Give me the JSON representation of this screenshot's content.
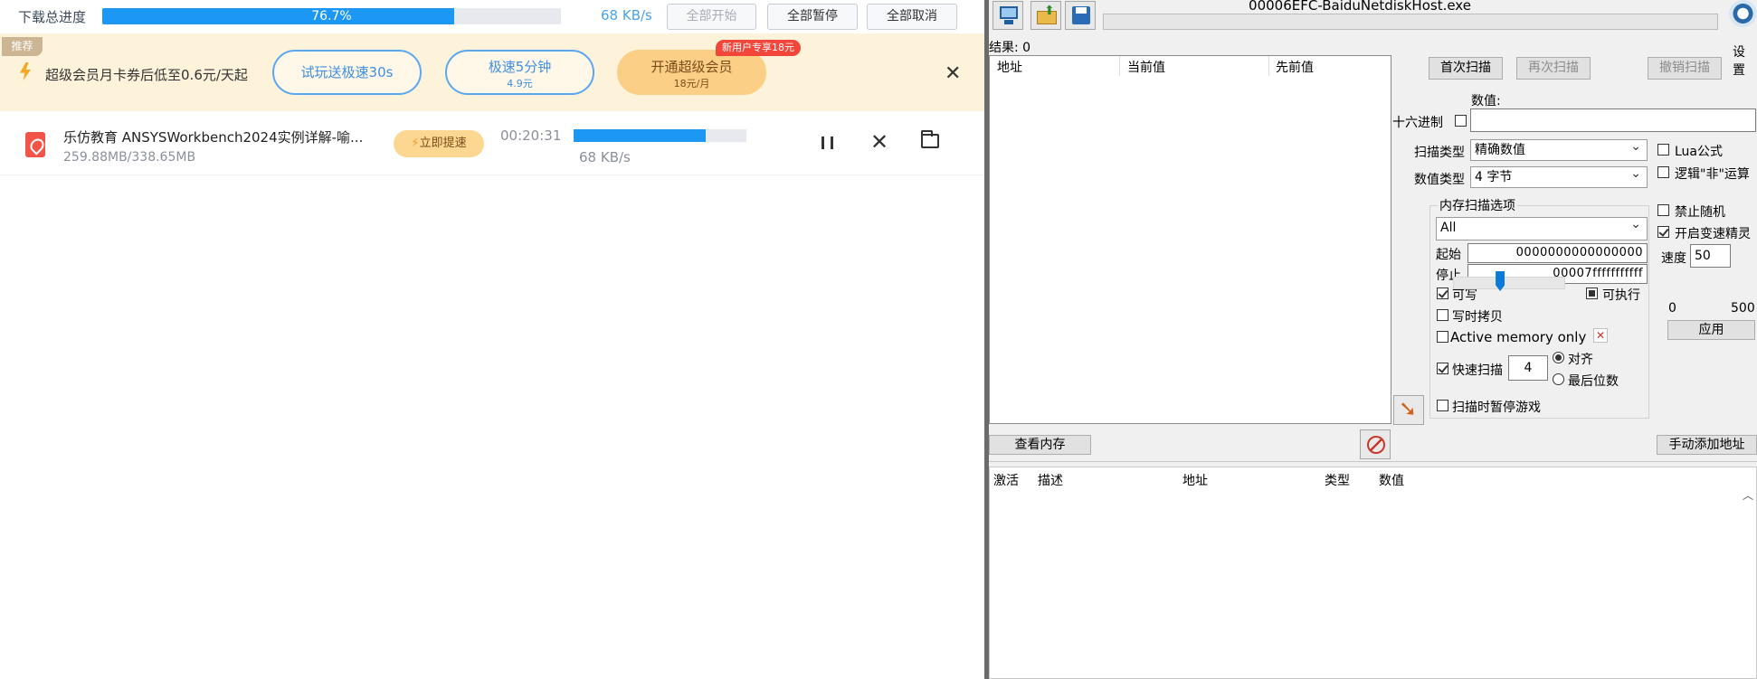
{
  "netdisk": {
    "total_label": "下载总进度",
    "total_progress_text": "76.7%",
    "total_progress": 0.767,
    "total_speed": "68 KB/s",
    "buttons": {
      "start_all": "全部开始",
      "pause_all": "全部暂停",
      "cancel_all": "全部取消"
    },
    "promo": {
      "tag": "推荐",
      "text": "超级会员月卡券后低至0.6元/天起",
      "trial": {
        "title": "试玩送极速30s"
      },
      "speed5": {
        "title": "极速5分钟",
        "sub": "4.9元"
      },
      "vip": {
        "title": "开通超级会员",
        "sub": "18元/月",
        "badge": "新用户专享18元"
      }
    },
    "download": {
      "name": "乐仿教育 ANSYSWorkbench2024实例详解-喻...",
      "size": "259.88MB/338.65MB",
      "boost": "立即提速",
      "eta": "00:20:31",
      "progress": 0.767,
      "speed": "68 KB/s"
    }
  },
  "ce": {
    "title": "00006EFC-BaiduNetdiskHost.exe",
    "settings": "设置",
    "results": "结果: 0",
    "columns": {
      "address": "地址",
      "current": "当前值",
      "previous": "先前值"
    },
    "buttons": {
      "first_scan": "首次扫描",
      "next_scan": "再次扫描",
      "undo_scan": "撤销扫描",
      "view_memory": "查看内存",
      "add_address": "手动添加地址",
      "apply": "应用"
    },
    "value_label": "数值:",
    "hex_label": "十六进制",
    "scan_type_label": "扫描类型",
    "scan_type_value": "精确数值",
    "value_type_label": "数值类型",
    "value_type_value": "4 字节",
    "lua_label": "Lua公式",
    "not_label": "逻辑\"非\"运算",
    "mem_group": "内存扫描选项",
    "region": "All",
    "start_label": "起始",
    "start_value": "0000000000000000",
    "stop_label": "停止",
    "stop_value": "00007fffffffffff",
    "writable": "可写",
    "executable": "可执行",
    "copy_on_write": "写时拷贝",
    "active_memory": "Active memory only",
    "fast_scan": "快速扫描",
    "fast_scan_value": "4",
    "align": "对齐",
    "last_digits": "最后位数",
    "pause_game": "扫描时暂停游戏",
    "no_random": "禁止随机",
    "speedhack": "开启变速精灵",
    "speed_label": "速度",
    "speed_value": "50",
    "slider_min": "0",
    "slider_max": "500",
    "slider_value": 50,
    "lower_columns": {
      "active": "激活",
      "desc": "描述",
      "address": "地址",
      "type": "类型",
      "value": "数值"
    }
  }
}
